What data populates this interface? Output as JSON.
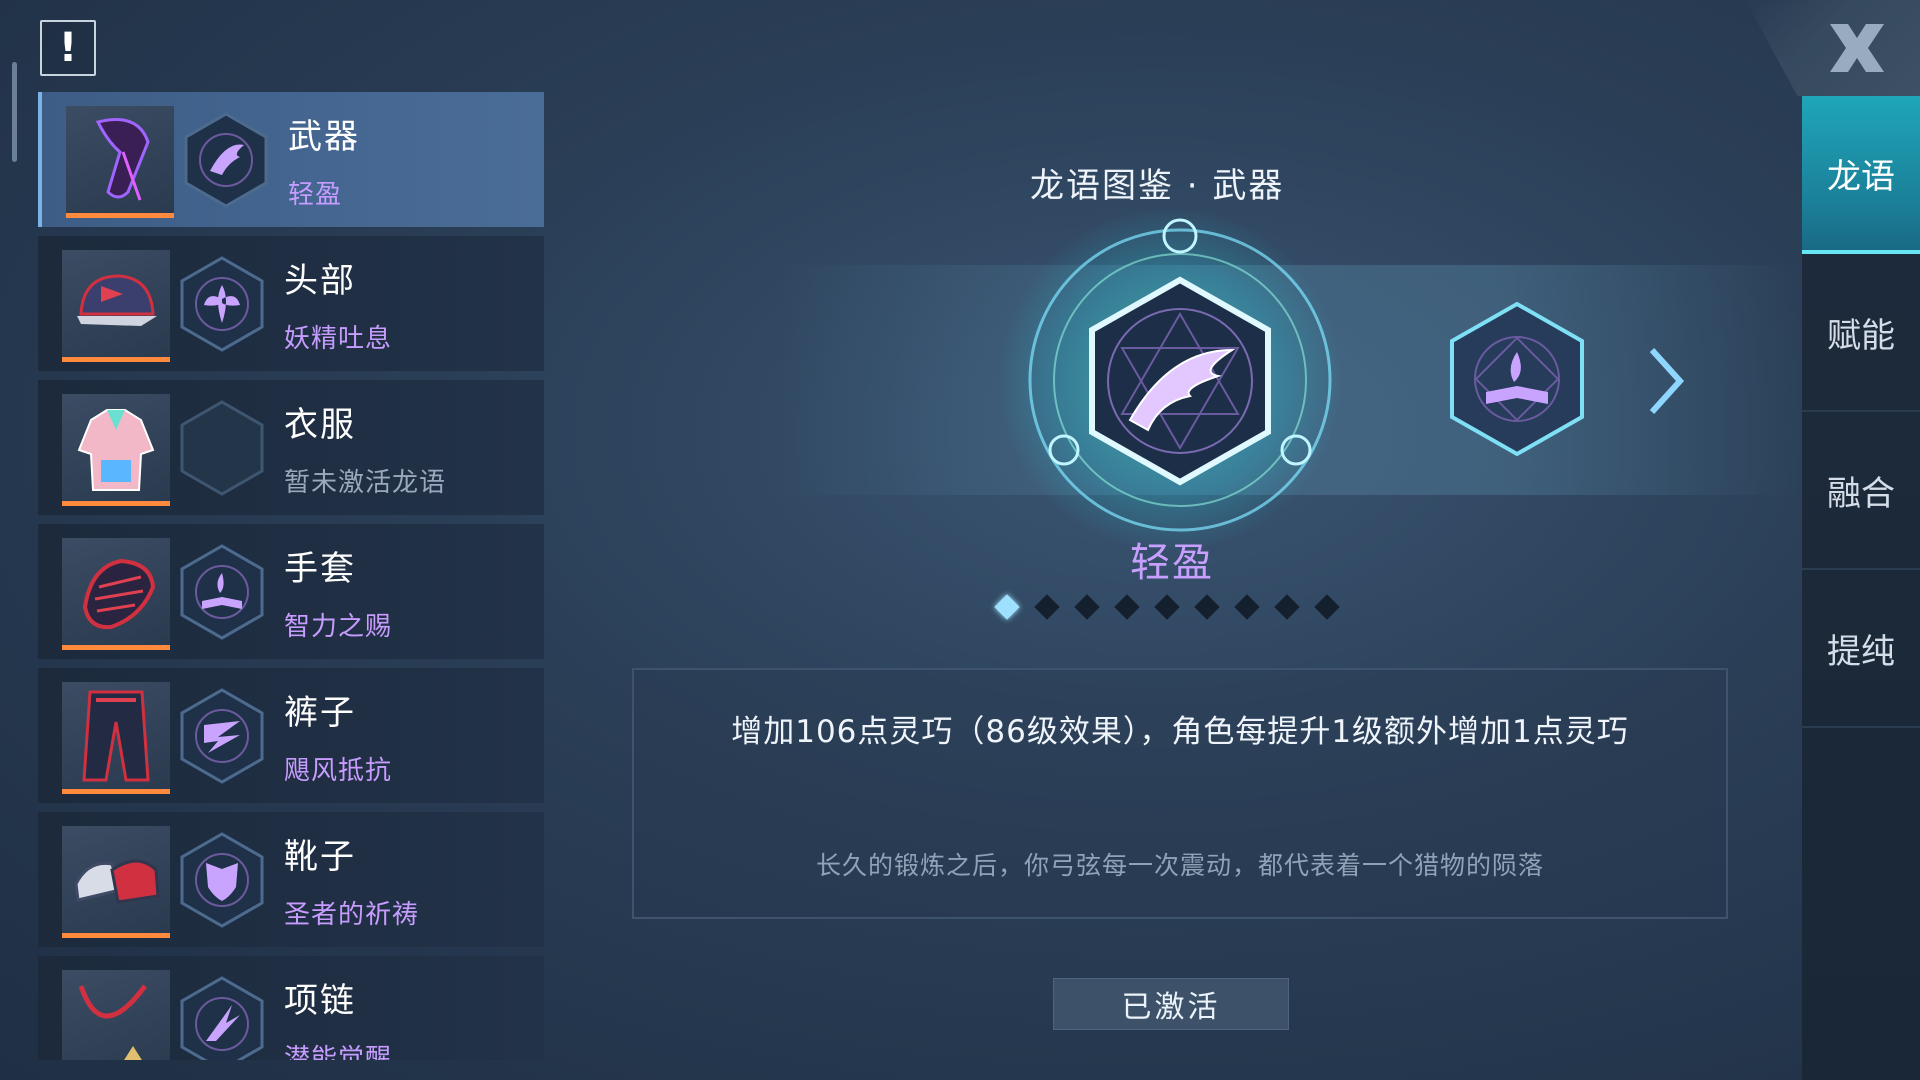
{
  "alert_icon": "exclamation-icon",
  "equipment": [
    {
      "slot": "武器",
      "rune": "轻盈",
      "thumb_icon": "weapon-icon",
      "rune_icon": "wing-rune-icon",
      "selected": true,
      "active": true
    },
    {
      "slot": "头部",
      "rune": "妖精吐息",
      "thumb_icon": "cap-icon",
      "rune_icon": "fairy-rune-icon",
      "selected": false,
      "active": true
    },
    {
      "slot": "衣服",
      "rune": "暂未激活龙语",
      "thumb_icon": "jacket-icon",
      "rune_icon": "empty-rune-icon",
      "selected": false,
      "active": false
    },
    {
      "slot": "手套",
      "rune": "智力之赐",
      "thumb_icon": "glove-icon",
      "rune_icon": "book-rune-icon",
      "selected": false,
      "active": true
    },
    {
      "slot": "裤子",
      "rune": "飓风抵抗",
      "thumb_icon": "pants-icon",
      "rune_icon": "storm-rune-icon",
      "selected": false,
      "active": true
    },
    {
      "slot": "靴子",
      "rune": "圣者的祈祷",
      "thumb_icon": "boots-icon",
      "rune_icon": "shield-rune-icon",
      "selected": false,
      "active": true
    },
    {
      "slot": "项链",
      "rune": "潜能觉醒",
      "thumb_icon": "necklace-icon",
      "rune_icon": "claw-rune-icon",
      "selected": false,
      "active": true
    }
  ],
  "codex": {
    "title": "龙语图鉴 · 武器",
    "emblem_name": "轻盈",
    "page_count": 9,
    "current_page": 1,
    "effect_text": "增加106点灵巧（86级效果），角色每提升1级额外增加1点灵巧",
    "flavor_text": "长久的锻炼之后，你弓弦每一次震动，都代表着一个猎物的陨落",
    "status_button": "已激活"
  },
  "tabs": [
    {
      "label": "龙语",
      "active": true
    },
    {
      "label": "赋能",
      "active": false
    },
    {
      "label": "融合",
      "active": false
    },
    {
      "label": "提纯",
      "active": false
    }
  ],
  "close_icon": "close-icon",
  "colors": {
    "accent_purple": "#c79cff",
    "accent_cyan": "#1fa6b8",
    "bar_orange": "#ff8a3d"
  }
}
